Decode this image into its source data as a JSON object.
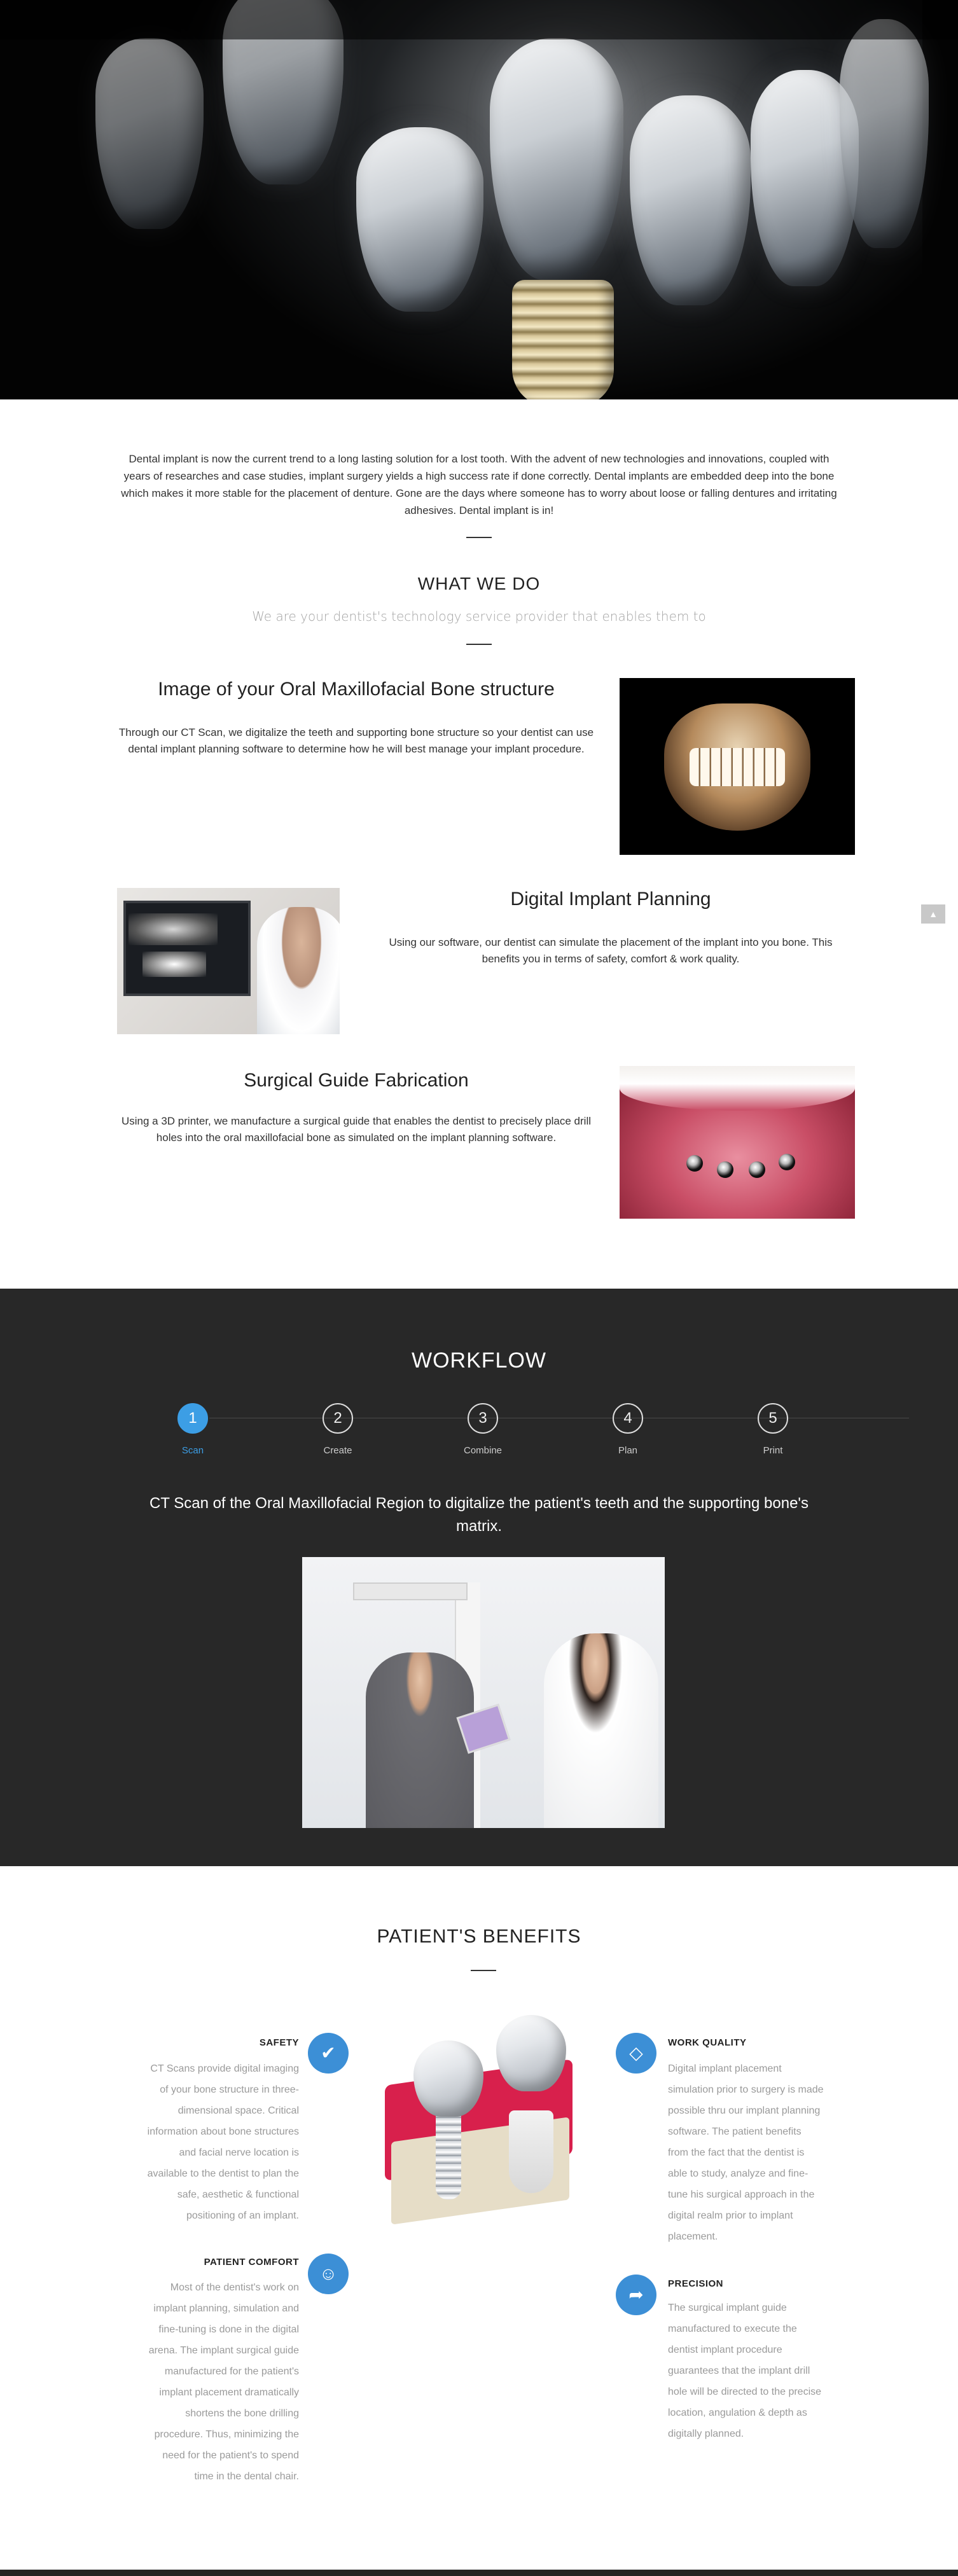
{
  "intro": {
    "text": "Dental implant is now the current trend to a long lasting solution for a lost tooth. With the advent of new technologies and innovations, coupled with years of researches and case studies, implant surgery yields a high success rate if done correctly. Dental implants are embedded deep into the bone which makes it more stable for the placement of denture. Gone are the days where someone has to worry about loose or falling dentures and irritating adhesives. Dental implant is in!"
  },
  "what_we_do": {
    "title": "WHAT WE DO",
    "subtitle": "We are your dentist's technology service provider that enables them to",
    "features": [
      {
        "title": "Image of your Oral Maxillofacial Bone structure",
        "text": "Through our CT Scan, we digitalize the teeth and supporting bone structure so your dentist can use dental implant planning software to determine how he will best manage your implant procedure."
      },
      {
        "title": "Digital Implant Planning",
        "text": "Using our software, our dentist can simulate the placement of the implant into you bone. This benefits you in terms of safety, comfort & work quality."
      },
      {
        "title": "Surgical Guide Fabrication",
        "text": "Using a 3D printer, we manufacture a surgical guide that enables the dentist to precisely place drill holes into the oral maxillofacial bone as simulated on the implant planning software."
      }
    ]
  },
  "workflow": {
    "title": "WORKFLOW",
    "steps": [
      {
        "number": "1",
        "label": "Scan"
      },
      {
        "number": "2",
        "label": "Create"
      },
      {
        "number": "3",
        "label": "Combine"
      },
      {
        "number": "4",
        "label": "Plan"
      },
      {
        "number": "5",
        "label": "Print"
      }
    ],
    "active_step": "Scan",
    "description": "CT Scan of the Oral Maxillofacial Region to digitalize the patient's teeth and the supporting bone's matrix."
  },
  "benefits": {
    "title": "PATIENT'S BENEFITS",
    "items": [
      {
        "title": "SAFETY",
        "icon": "check-icon",
        "lines": [
          "CT Scans provide digital imaging",
          "of your bone structure in three-",
          "dimensional space. Critical",
          "information about bone structures",
          "and facial nerve location is",
          "available to the dentist to plan the",
          "safe, aesthetic & functional",
          "positioning of an implant."
        ]
      },
      {
        "title": "PATIENT COMFORT",
        "icon": "smile-icon",
        "lines": [
          "Most of the dentist's work on",
          "implant planning, simulation and",
          "fine-tuning is done in the digital",
          "arena. The implant surgical guide",
          "manufactured for the patient's",
          "implant placement dramatically",
          "shortens the bone drilling",
          "procedure. Thus, minimizing the",
          "need for the patient's to spend",
          "time in the dental chair."
        ]
      },
      {
        "title": "WORK QUALITY",
        "icon": "diamond-icon",
        "lines": [
          "Digital implant placement",
          "simulation prior to surgery is made",
          "possible thru our implant planning",
          "software. The patient benefits",
          "from the fact that the dentist is",
          "able to study, analyze and fine-",
          "tune his surgical approach in the",
          "digital realm prior to implant",
          "placement."
        ]
      },
      {
        "title": "PRECISION",
        "icon": "bolt-icon",
        "lines": [
          "The surgical implant guide",
          "manufactured to execute the",
          "dentist implant procedure",
          "guarantees that the implant drill",
          "hole will be directed to the precise",
          "location, angulation & depth as",
          "digitally planned."
        ]
      }
    ]
  },
  "colors": {
    "accent": "#3c9ee5",
    "workflow_bg": "#282828",
    "benefit_icon": "#3c8fd6"
  }
}
